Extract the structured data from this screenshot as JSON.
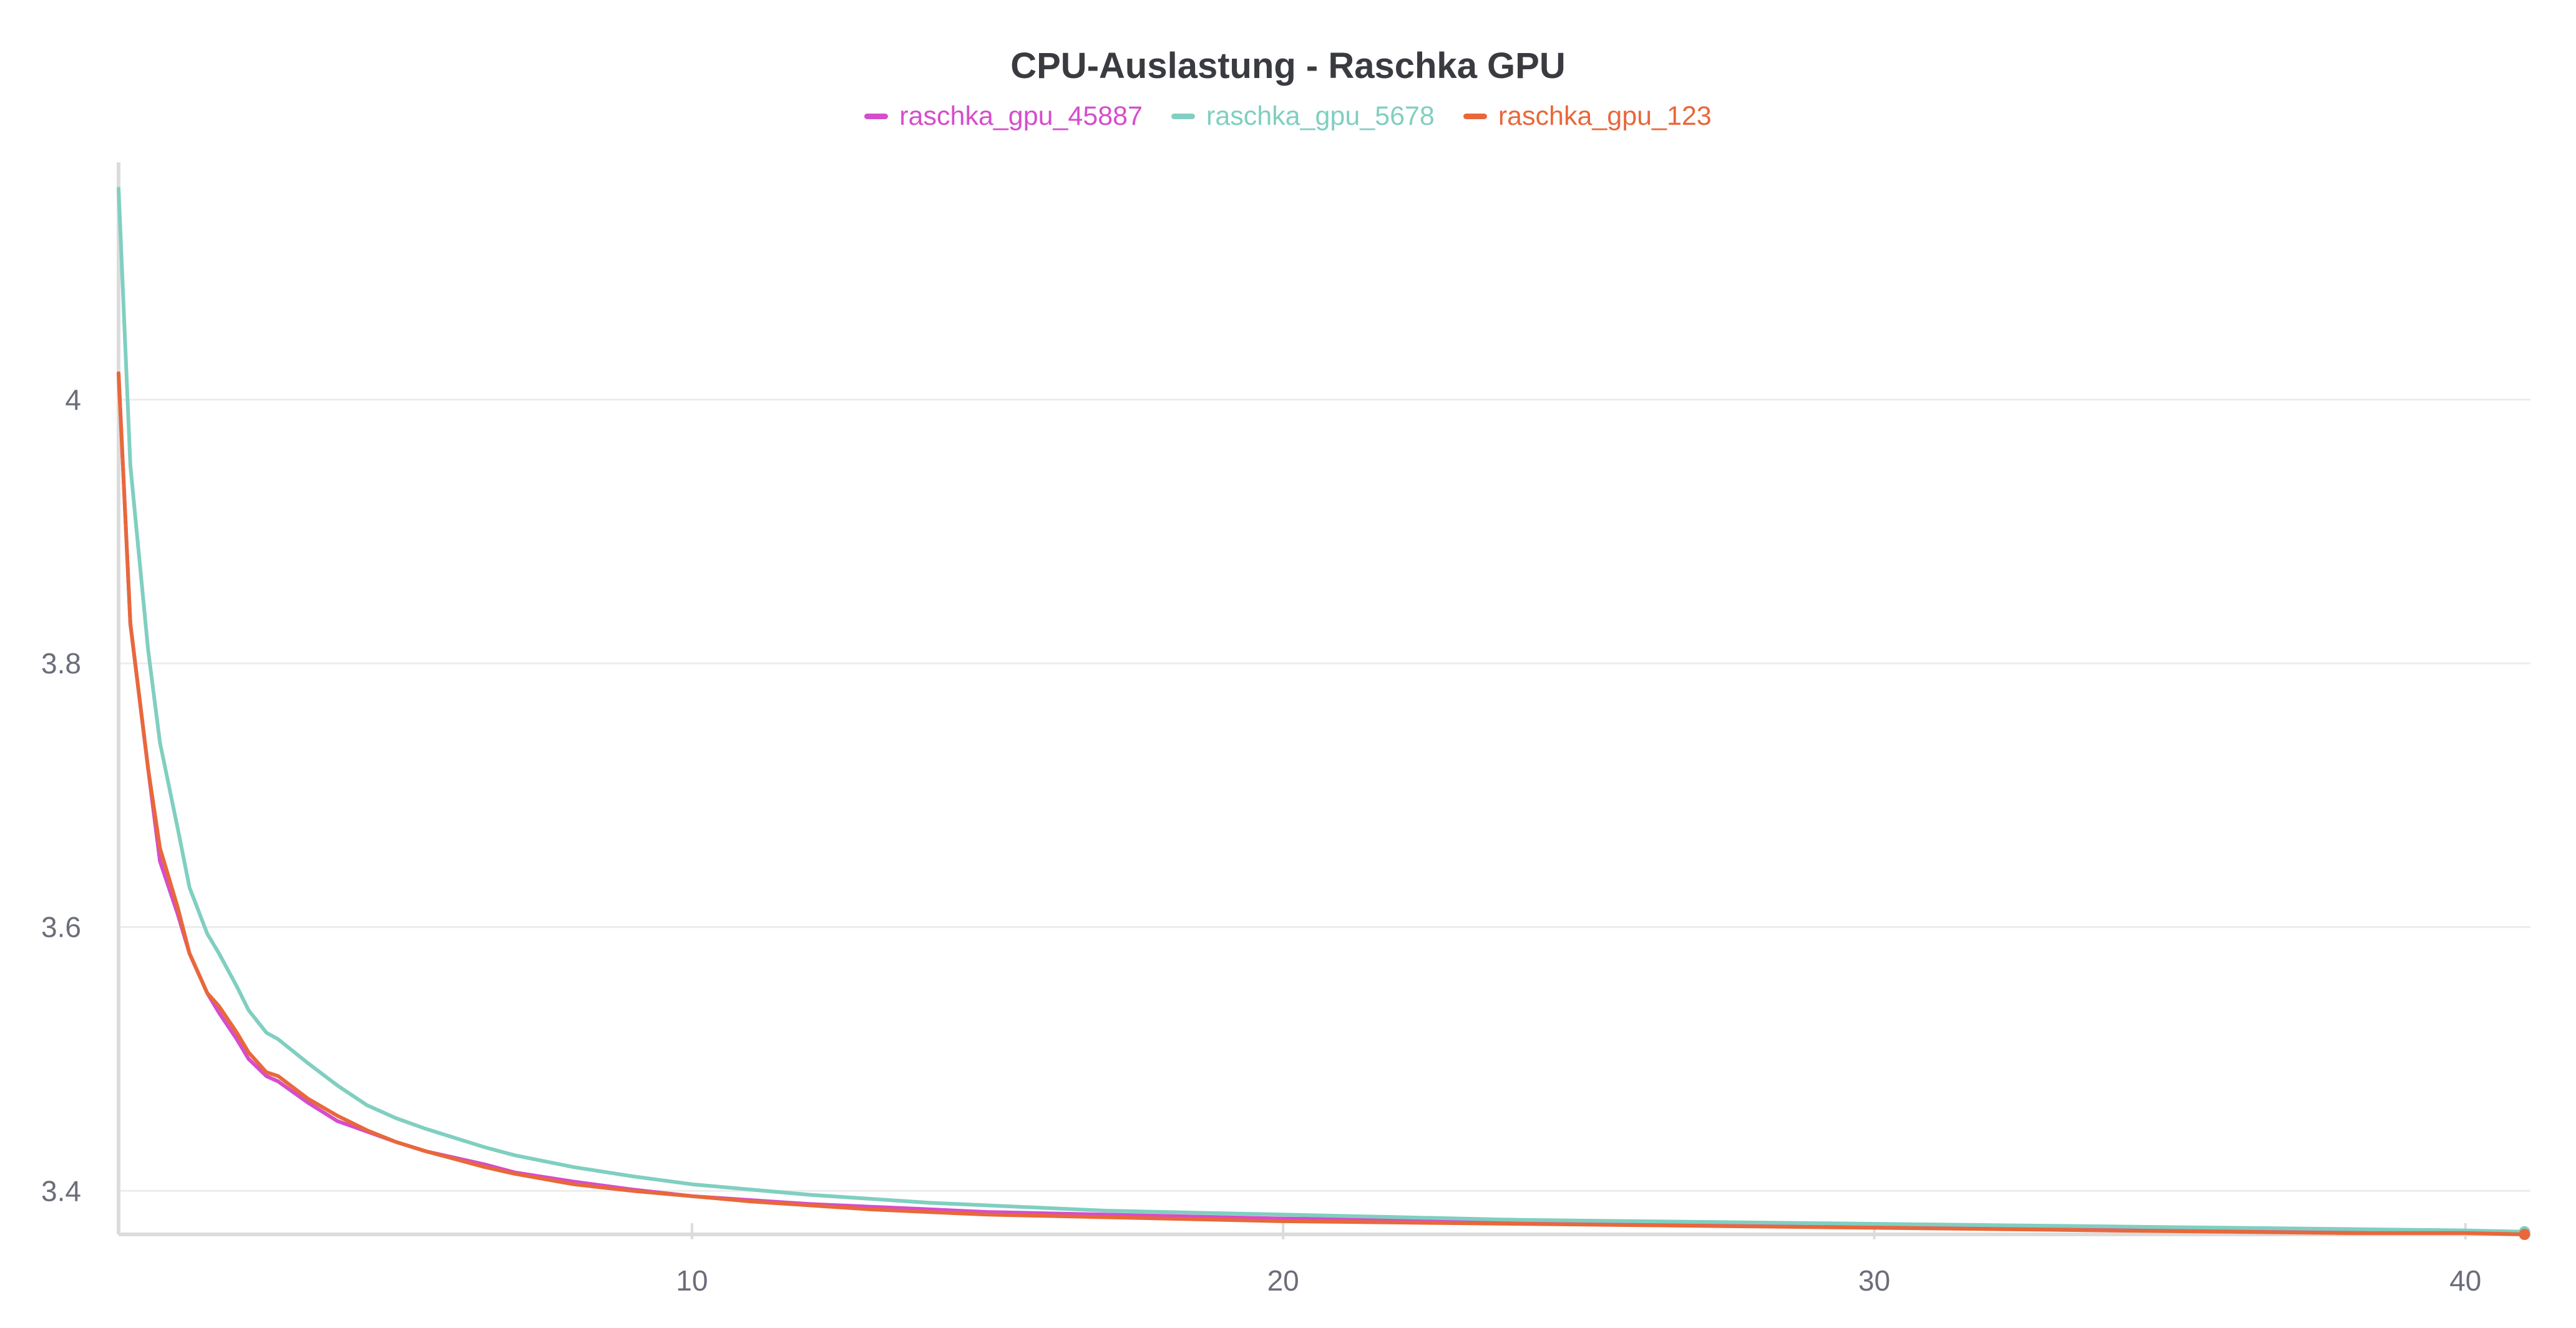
{
  "chart_data": {
    "type": "line",
    "title": "CPU-Auslastung - Raschka GPU",
    "xlabel": "",
    "ylabel": "",
    "xlim": [
      0.3,
      41.1
    ],
    "ylim": [
      3.367,
      4.18
    ],
    "x_ticks": [
      10,
      20,
      30,
      40
    ],
    "y_ticks": [
      3.4,
      3.6,
      3.8,
      4
    ],
    "x_tick_labels": [
      "10",
      "20",
      "30",
      "40"
    ],
    "y_tick_labels": [
      "3.4",
      "3.6",
      "3.8",
      "4"
    ],
    "grid": "horizontal",
    "legend_position": "top-center",
    "series": [
      {
        "name": "raschka_gpu_45887",
        "color": "#d64dcb",
        "x": [
          0.3,
          0.5,
          0.8,
          1.0,
          1.3,
          1.5,
          1.8,
          2.0,
          2.3,
          2.5,
          2.8,
          3.0,
          3.5,
          4.0,
          4.5,
          5.0,
          5.5,
          6.0,
          6.5,
          7.0,
          8.0,
          9.0,
          10.0,
          11.0,
          12.0,
          13.0,
          14.0,
          15.0,
          16.0,
          17.0,
          18.0,
          19.0,
          20.0,
          22.0,
          24.0,
          26.0,
          28.0,
          30.0,
          32.0,
          34.0,
          36.0,
          38.0,
          40.0,
          41.0
        ],
        "y": [
          4.02,
          3.83,
          3.72,
          3.65,
          3.61,
          3.58,
          3.55,
          3.535,
          3.515,
          3.5,
          3.487,
          3.483,
          3.467,
          3.453,
          3.445,
          3.437,
          3.43,
          3.425,
          3.42,
          3.414,
          3.407,
          3.401,
          3.396,
          3.393,
          3.39,
          3.388,
          3.386,
          3.384,
          3.383,
          3.382,
          3.381,
          3.38,
          3.379,
          3.378,
          3.377,
          3.376,
          3.375,
          3.374,
          3.373,
          3.372,
          3.371,
          3.37,
          3.369,
          3.368
        ]
      },
      {
        "name": "raschka_gpu_5678",
        "color": "#80cfc0",
        "x": [
          0.3,
          0.5,
          0.8,
          1.0,
          1.3,
          1.5,
          1.8,
          2.0,
          2.3,
          2.5,
          2.8,
          3.0,
          3.5,
          4.0,
          4.5,
          5.0,
          5.5,
          6.0,
          6.5,
          7.0,
          8.0,
          9.0,
          10.0,
          11.0,
          12.0,
          13.0,
          14.0,
          15.0,
          16.0,
          17.0,
          18.0,
          19.0,
          20.0,
          22.0,
          24.0,
          26.0,
          28.0,
          30.0,
          32.0,
          34.0,
          36.0,
          38.0,
          40.0,
          41.0
        ],
        "y": [
          4.16,
          3.95,
          3.81,
          3.74,
          3.675,
          3.63,
          3.595,
          3.58,
          3.555,
          3.537,
          3.52,
          3.515,
          3.497,
          3.48,
          3.465,
          3.455,
          3.447,
          3.44,
          3.433,
          3.427,
          3.418,
          3.411,
          3.405,
          3.401,
          3.397,
          3.394,
          3.391,
          3.389,
          3.387,
          3.385,
          3.384,
          3.383,
          3.382,
          3.38,
          3.378,
          3.377,
          3.376,
          3.375,
          3.374,
          3.373,
          3.372,
          3.371,
          3.37,
          3.369
        ]
      },
      {
        "name": "raschka_gpu_123",
        "color": "#e8683a",
        "x": [
          0.3,
          0.5,
          0.8,
          1.0,
          1.3,
          1.5,
          1.8,
          2.0,
          2.3,
          2.5,
          2.8,
          3.0,
          3.5,
          4.0,
          4.5,
          5.0,
          5.5,
          6.0,
          6.5,
          7.0,
          8.0,
          9.0,
          10.0,
          11.0,
          12.0,
          13.0,
          14.0,
          15.0,
          16.0,
          17.0,
          18.0,
          19.0,
          20.0,
          22.0,
          24.0,
          26.0,
          28.0,
          30.0,
          32.0,
          34.0,
          36.0,
          38.0,
          40.0,
          41.0
        ],
        "y": [
          4.02,
          3.83,
          3.72,
          3.66,
          3.615,
          3.58,
          3.55,
          3.54,
          3.52,
          3.505,
          3.49,
          3.487,
          3.47,
          3.457,
          3.446,
          3.437,
          3.43,
          3.424,
          3.418,
          3.413,
          3.405,
          3.4,
          3.396,
          3.392,
          3.389,
          3.386,
          3.384,
          3.382,
          3.381,
          3.38,
          3.379,
          3.378,
          3.377,
          3.376,
          3.375,
          3.374,
          3.373,
          3.372,
          3.371,
          3.37,
          3.369,
          3.368,
          3.368,
          3.367
        ]
      }
    ]
  }
}
